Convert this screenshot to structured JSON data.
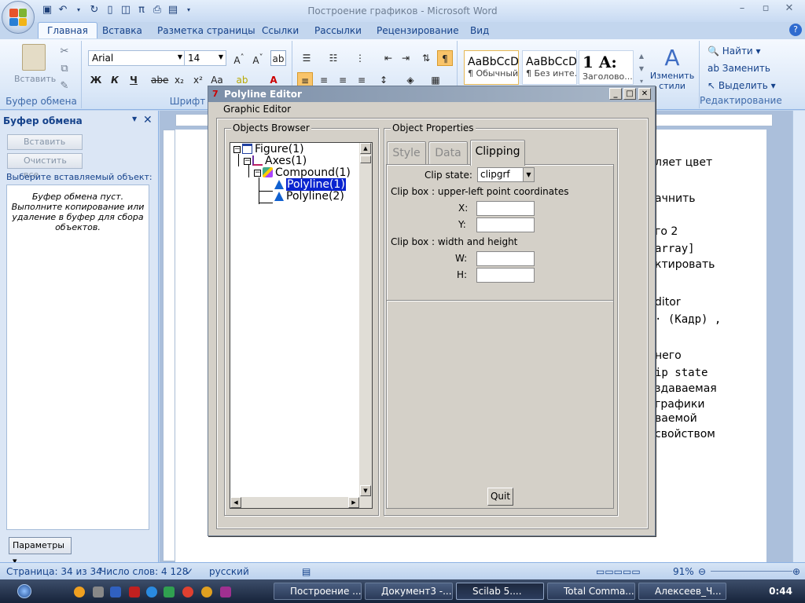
{
  "word": {
    "title": "Построение графиков - Microsoft Word",
    "tabs": [
      "Главная",
      "Вставка",
      "Разметка страницы",
      "Ссылки",
      "Рассылки",
      "Рецензирование",
      "Вид"
    ],
    "ribbon": {
      "clipboard_group": "Буфер обмена",
      "paste_label": "Вставить",
      "font_group": "Шрифт",
      "font_name": "Arial",
      "font_size": "14",
      "styles": [
        {
          "preview": "AaBbCcDc",
          "caption": "¶ Обычный"
        },
        {
          "preview": "AaBbCcDc",
          "caption": "¶ Без инте..."
        },
        {
          "preview": "1 A:",
          "caption": "Заголово..."
        }
      ],
      "change_styles": "Изменить стили",
      "find": "Найти",
      "replace": "Заменить",
      "select": "Выделить",
      "editing_group": "Редактирование"
    },
    "clipboard_pane": {
      "title": "Буфер обмена",
      "paste_all": "Вставить все",
      "clear_all": "Очистить все",
      "hint": "Выберите вставляемый объект:",
      "empty_msg": "Буфер обмена пуст. Выполните копирование или удаление в буфер для сбора объектов.",
      "params": "Параметры"
    },
    "document_lines": [
      "ляет цвет",
      "ачнить",
      "го 2",
      "array]",
      "ктировать",
      "ditor",
      "· (Кадр) ,",
      "него",
      "ip state",
      "здаваемая",
      "графики",
      "ваемой",
      "свойством"
    ],
    "status": {
      "page": "Страница: 34 из 34",
      "words": "Число слов: 4 128",
      "lang": "русский",
      "zoom": "91%"
    }
  },
  "taskbar": {
    "tasks": [
      "Построение ...",
      "Документ3 -...",
      "Scilab 5....",
      "Total Comma...",
      "Алексеев_Ч..."
    ],
    "clock": "0:44"
  },
  "dialog": {
    "title": "Polyline Editor",
    "menu": "Graphic Editor",
    "objects_browser": "Objects Browser",
    "object_properties": "Object Properties",
    "tree": [
      {
        "label": "Figure(1)",
        "level": 0,
        "selected": false
      },
      {
        "label": "Axes(1)",
        "level": 1,
        "selected": false
      },
      {
        "label": "Compound(1)",
        "level": 2,
        "selected": false
      },
      {
        "label": "Polyline(1)",
        "level": 3,
        "selected": true
      },
      {
        "label": "Polyline(2)",
        "level": 3,
        "selected": false
      }
    ],
    "tabs": [
      "Style",
      "Data",
      "Clipping"
    ],
    "active_tab": "Clipping",
    "clip_state_label": "Clip state:",
    "clip_state_value": "clipgrf",
    "upper_left_label": "Clip box : upper-left point coordinates",
    "x_label": "X:",
    "y_label": "Y:",
    "wh_label": "Clip box : width and height",
    "w_label": "W:",
    "h_label": "H:",
    "quit": "Quit"
  }
}
